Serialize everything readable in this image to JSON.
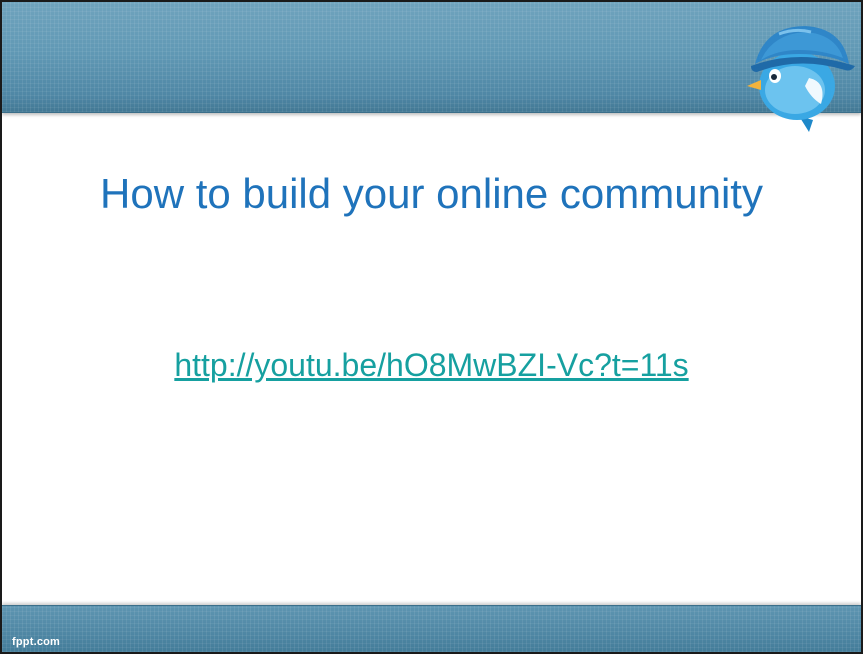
{
  "slide": {
    "title": "How to build your online community",
    "link_text": "http://youtu.be/hO8MwBZI-Vc?t=11s",
    "footer_brand": "fppt.com"
  },
  "icons": {
    "mascot": "bird-mascot-icon"
  },
  "colors": {
    "title": "#1f73bb",
    "link": "#16a0a0",
    "band": "#5e95b1",
    "background": "#ffffff"
  }
}
